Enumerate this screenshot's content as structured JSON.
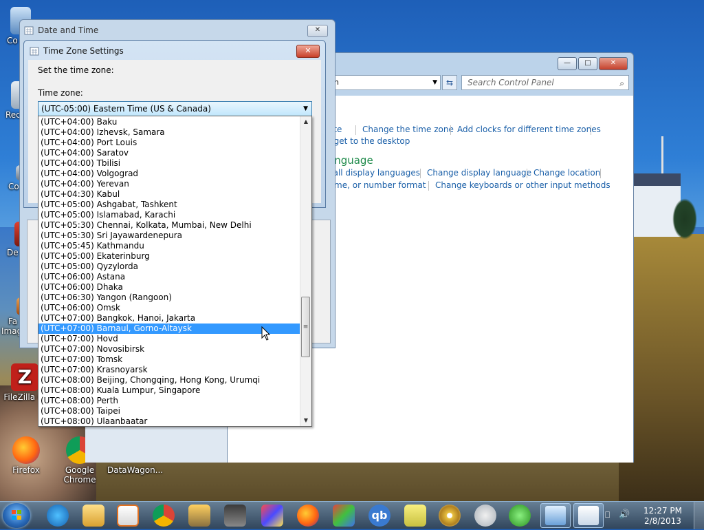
{
  "desktop": {
    "icons": [
      {
        "label": "Co"
      },
      {
        "label": "Rec"
      },
      {
        "label": "Co"
      },
      {
        "label": "De"
      },
      {
        "label": "Fa"
      },
      {
        "label": "Imag"
      },
      {
        "label": "FileZilla Cl"
      },
      {
        "label": "Firefox"
      },
      {
        "label": "Google Chrome"
      },
      {
        "label": "DataWagon..."
      }
    ]
  },
  "control_panel": {
    "address_text": "n",
    "search_placeholder": "Search Control Panel",
    "sections": [
      {
        "heading": "e",
        "links": [
          "ate",
          "Change the time zone",
          "Add clocks for different time zones"
        ],
        "links2": [
          "dget to the desktop"
        ]
      },
      {
        "heading": "anguage",
        "links": [
          "call display languages",
          "Change display language",
          "Change location"
        ],
        "links2": [
          "time, or number format",
          "Change keyboards or other input methods"
        ]
      }
    ]
  },
  "date_time_dialog": {
    "title": "Date and Time",
    "close_label": "✕"
  },
  "time_zone_dialog": {
    "title": "Time Zone Settings",
    "close_label": "✕",
    "instruction": "Set the time zone:",
    "zone_label": "Time zone:",
    "selected_value": "(UTC-05:00) Eastern Time (US & Canada)",
    "options": [
      "(UTC+04:00) Baku",
      "(UTC+04:00) Izhevsk, Samara",
      "(UTC+04:00) Port Louis",
      "(UTC+04:00) Saratov",
      "(UTC+04:00) Tbilisi",
      "(UTC+04:00) Volgograd",
      "(UTC+04:00) Yerevan",
      "(UTC+04:30) Kabul",
      "(UTC+05:00) Ashgabat, Tashkent",
      "(UTC+05:00) Islamabad, Karachi",
      "(UTC+05:30) Chennai, Kolkata, Mumbai, New Delhi",
      "(UTC+05:30) Sri Jayawardenepura",
      "(UTC+05:45) Kathmandu",
      "(UTC+05:00) Ekaterinburg",
      "(UTC+05:00) Qyzylorda",
      "(UTC+06:00) Astana",
      "(UTC+06:00) Dhaka",
      "(UTC+06:30) Yangon (Rangoon)",
      "(UTC+06:00) Omsk",
      "(UTC+07:00) Bangkok, Hanoi, Jakarta",
      "(UTC+07:00) Barnaul, Gorno-Altaysk",
      "(UTC+07:00) Hovd",
      "(UTC+07:00) Novosibirsk",
      "(UTC+07:00) Tomsk",
      "(UTC+07:00) Krasnoyarsk",
      "(UTC+08:00) Beijing, Chongqing, Hong Kong, Urumqi",
      "(UTC+08:00) Kuala Lumpur, Singapore",
      "(UTC+08:00) Perth",
      "(UTC+08:00) Taipei",
      "(UTC+08:00) Ulaanbaatar"
    ],
    "highlighted_index": 20
  },
  "taskbar": {
    "clock_time": "12:27 PM",
    "clock_date": "2/8/2013"
  },
  "colors": {
    "highlight": "#3399ff",
    "link": "#1a5fa8",
    "heading": "#1e8a4a"
  }
}
